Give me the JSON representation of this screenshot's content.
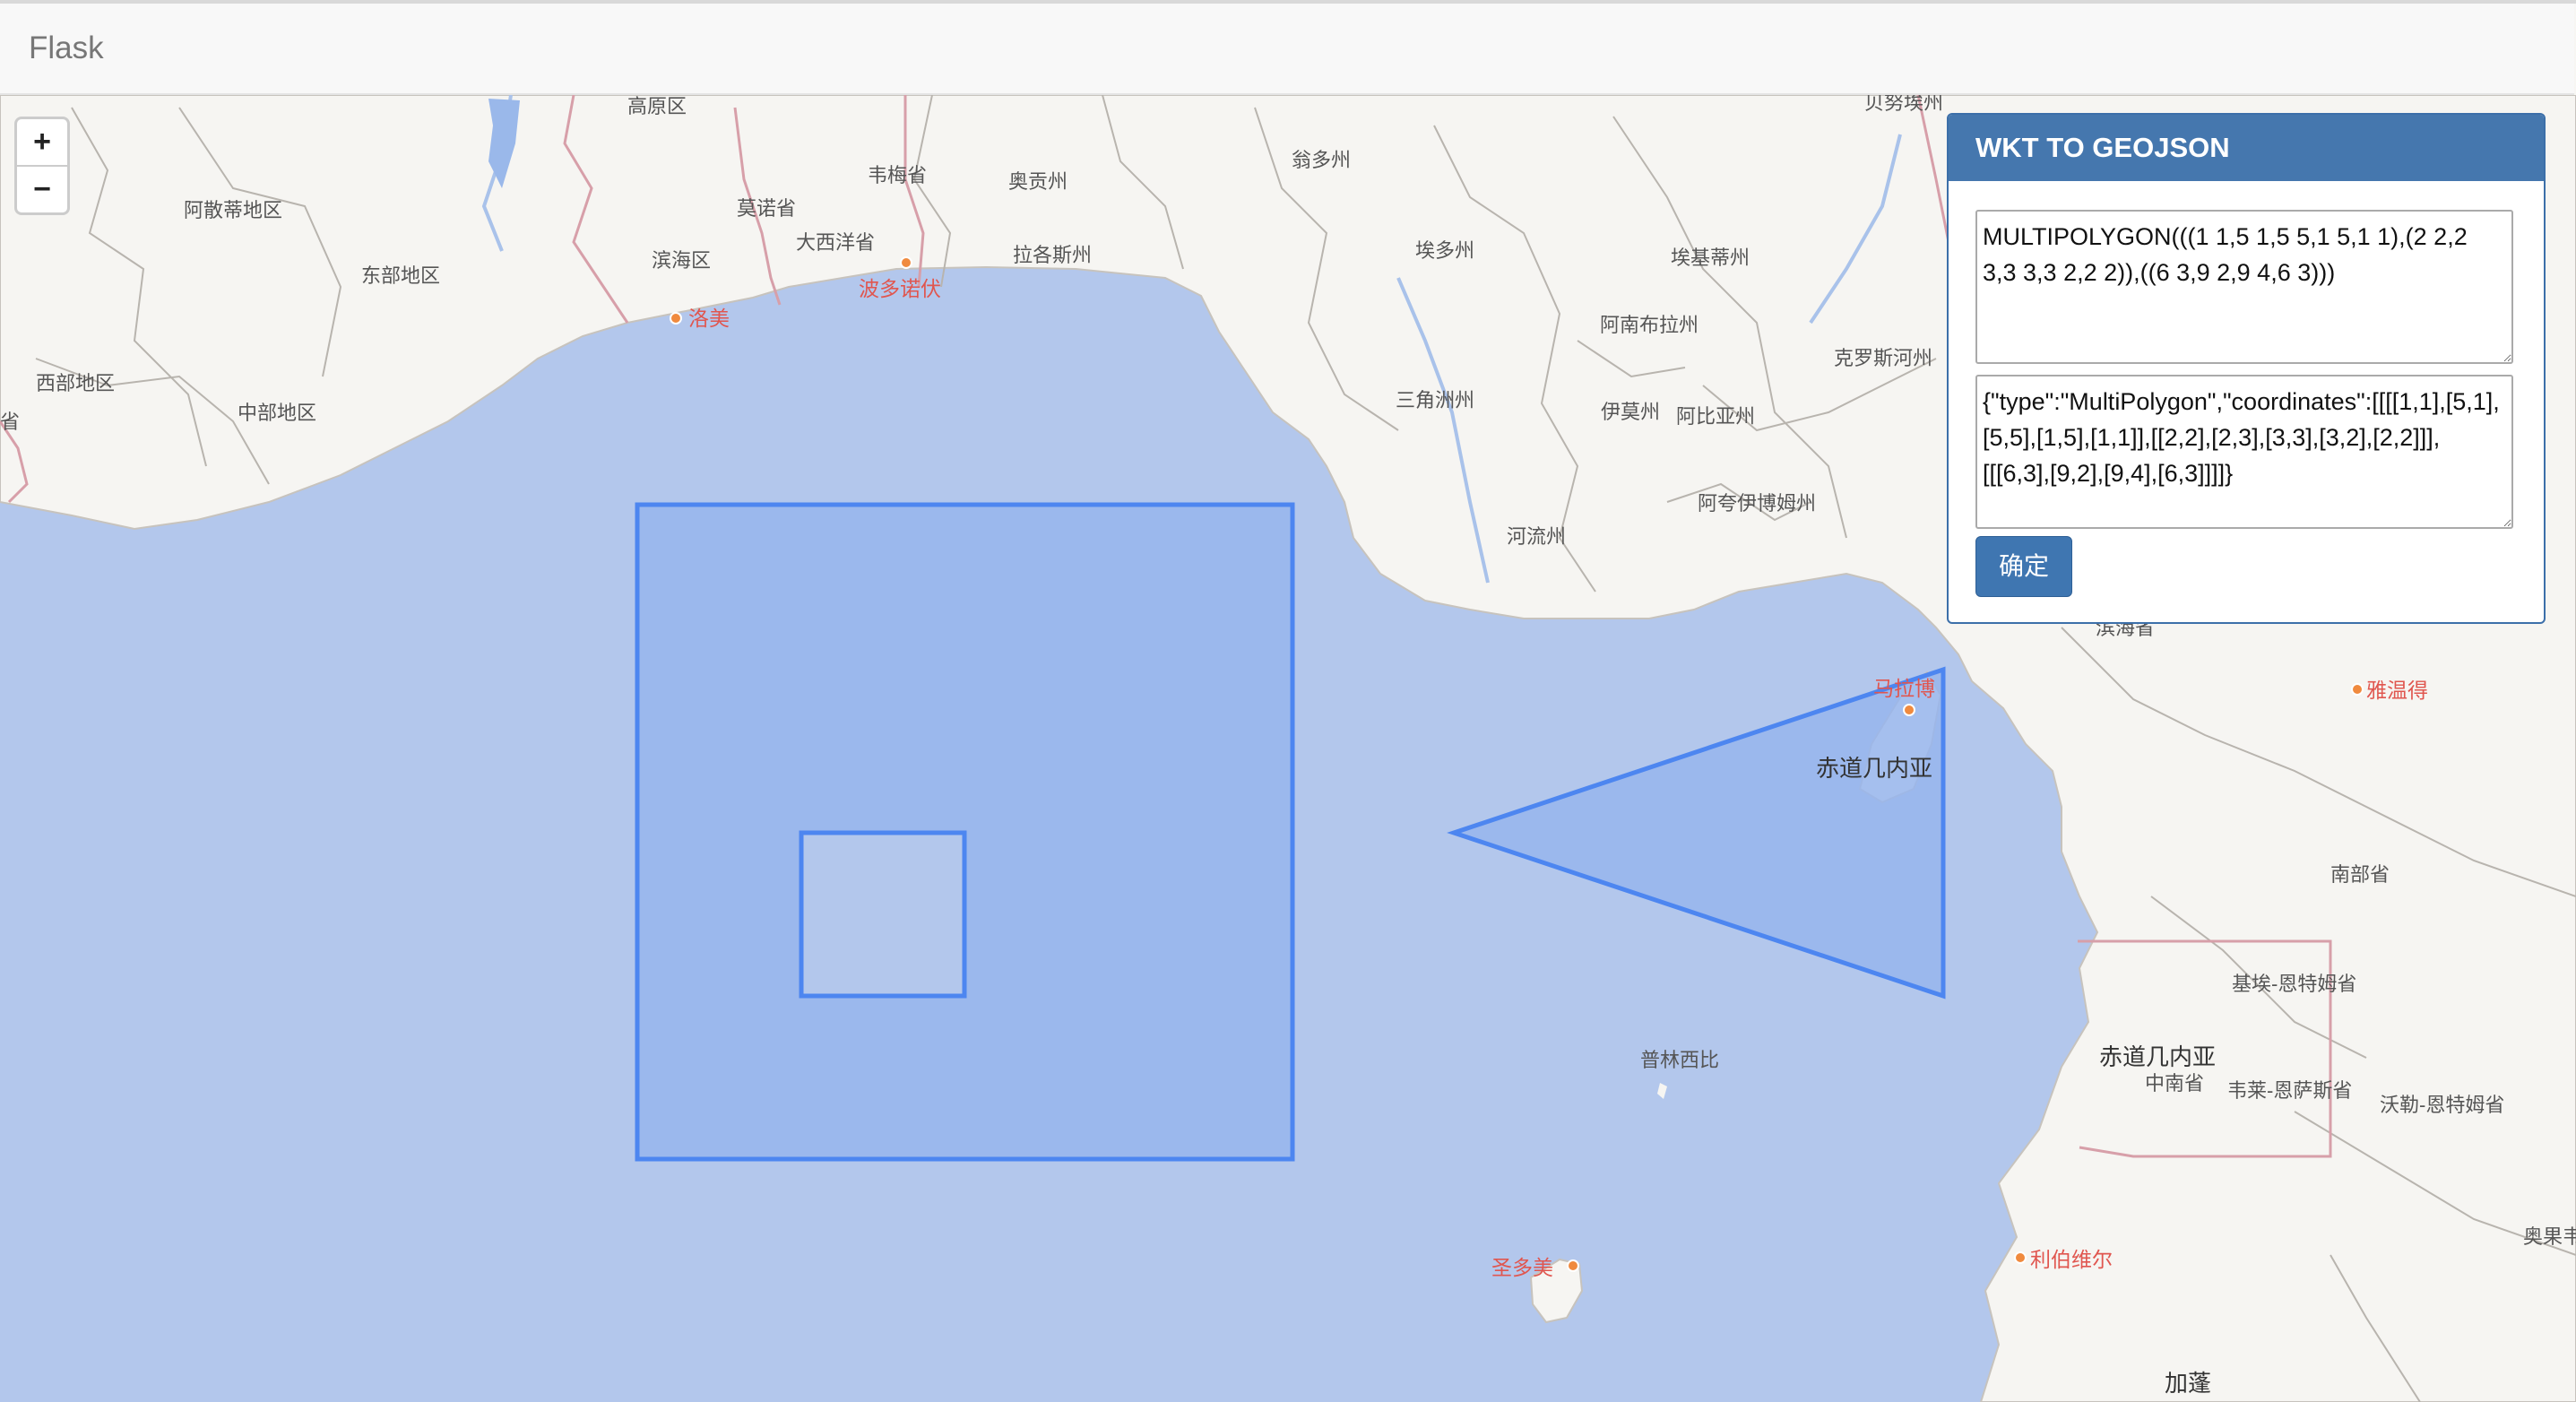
{
  "navbar": {
    "brand": "Flask"
  },
  "zoom": {
    "in_label": "+",
    "out_label": "−"
  },
  "panel": {
    "title": "WKT TO GEOJSON",
    "wkt_value": "MULTIPOLYGON(((1 1,5 1,5 5,1 5,1 1),(2 2,2 3,3 3,3 2,2 2)),((6 3,9 2,9 4,6 3)))",
    "geojson_value": "{\"type\":\"MultiPolygon\",\"coordinates\":[[[[1,1],[5,1],[5,5],[1,5],[1,1]],[[2,2],[2,3],[3,3],[3,2],[2,2]]],[[[6,3],[9,2],[9,4],[6,3]]]]}",
    "confirm_label": "确定"
  },
  "map_labels": {
    "gaoyuan": "高原区",
    "ahanfo": "阿散蒂地区",
    "dongbu": "东部地区",
    "xibu": "西部地区",
    "zhongbu": "中部地区",
    "binhai": "滨海区",
    "monuo": "莫诺省",
    "weimei": "韦梅省",
    "daxiyang": "大西洋省",
    "aoyan": "奥贡州",
    "lagos": "拉各斯州",
    "wengduo": "翁多州",
    "aiji": "埃多州",
    "aikitiki": "埃基蒂州",
    "anambra": "阿南布拉州",
    "kros": "克罗斯河州",
    "sanjiaozhou": "三角洲州",
    "yimo": "伊莫州",
    "abiya": "阿比亚州",
    "akwa": "阿夸伊博姆州",
    "heliu": "河流州",
    "beiwei": "贝努埃州",
    "binhai2": "滨海省",
    "eqguinea": "赤道几内亚",
    "principe": "普林西比",
    "saotome": "圣多美",
    "nanbu": "南部省",
    "jiyue": "基埃-恩特姆省",
    "eqguinea2": "赤道几内亚",
    "zhongnan": "中南省",
    "weilai": "韦莱-恩萨斯省",
    "wolei": "沃勒-恩特姆省",
    "gabon": "加蓬",
    "aoguyi": "奥果韦-伊温",
    "lome": "洛美",
    "portonovo": "波多诺伏",
    "malabo": "马拉博",
    "yaounde": "雅温得",
    "libreville": "利伯维尔",
    "sheng": "省"
  },
  "colors": {
    "sea": "#b3c7ec",
    "land": "#f6f5f2",
    "polygon_fill": "#97b5ed",
    "polygon_stroke": "#4d86f0",
    "header": "#4577ae",
    "button": "#3f76b1",
    "city_label": "#e0564f"
  }
}
